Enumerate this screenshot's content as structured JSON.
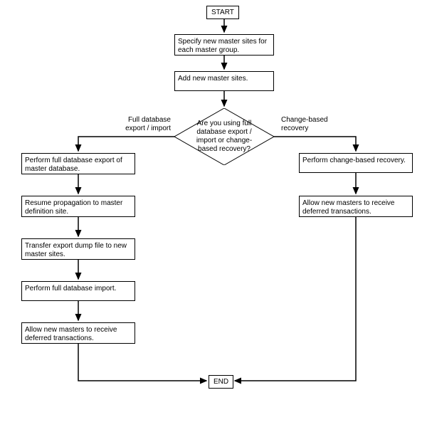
{
  "chart_data": {
    "type": "flowchart",
    "nodes": {
      "start": "START",
      "specify": "Specify new master sites for each master group.",
      "add": "Add new master sites.",
      "decision": "Are you using full database export / import or change-based recovery?",
      "leftLabel": "Full database export / import",
      "rightLabel": "Change-based recovery",
      "leftBranch": [
        "Perform full database export of master database.",
        "Resume propagation to master definition site.",
        "Transfer export dump file to new master sites.",
        "Perform full database import.",
        "Allow new masters to receive deferred transactions."
      ],
      "rightBranch": [
        "Perform change-based recovery.",
        "Allow new masters to receive deferred transactions."
      ],
      "end": "END"
    }
  }
}
